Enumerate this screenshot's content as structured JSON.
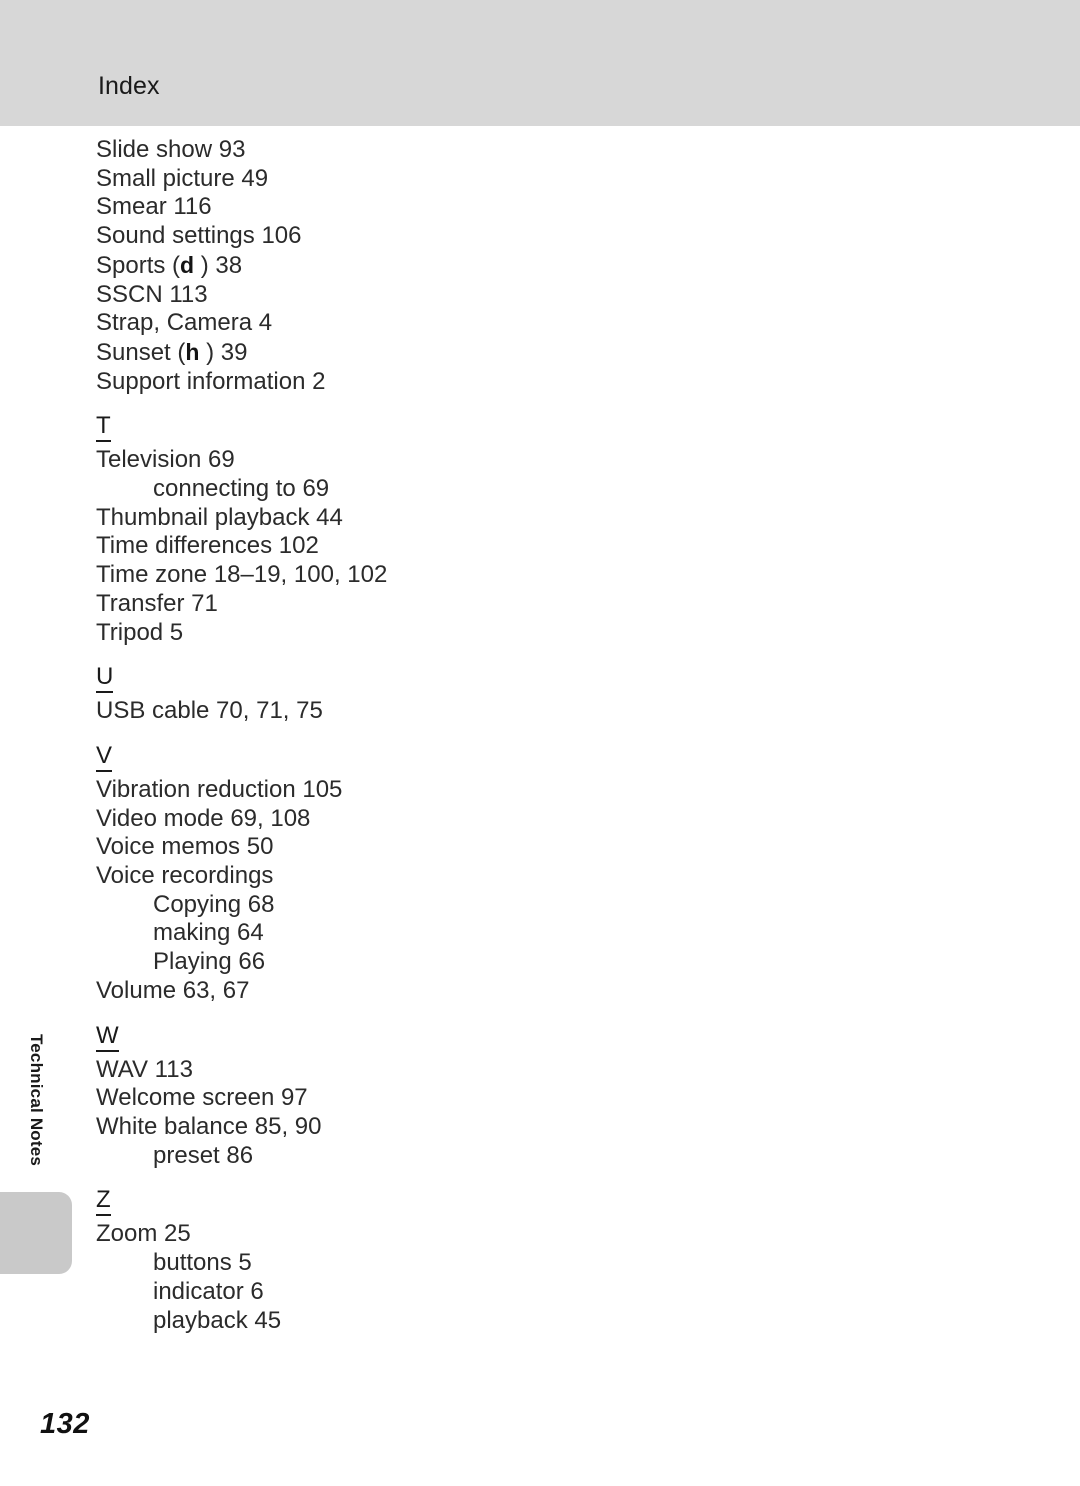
{
  "header": {
    "title": "Index",
    "band_color": "#d7d7d7"
  },
  "side_tab": {
    "label": "Technical Notes",
    "tab_color": "#c9c9c9"
  },
  "page": {
    "number": "132"
  },
  "index": {
    "continued_entries": [
      {
        "text": "Slide show 93",
        "level": 0
      },
      {
        "text": "Small picture 49",
        "level": 0
      },
      {
        "text": "Smear 116",
        "level": 0
      },
      {
        "text": "Sound settings 106",
        "level": 0
      },
      {
        "text": "Sports (",
        "glyph": "d",
        "text_after": " ) 38",
        "level": 0,
        "has_glyph": true
      },
      {
        "text": "SSCN 113",
        "level": 0
      },
      {
        "text": "Strap, Camera 4",
        "level": 0
      },
      {
        "text": "Sunset (",
        "glyph": "h",
        "text_after": " ) 39",
        "level": 0,
        "has_glyph": true
      },
      {
        "text": "Support information 2",
        "level": 0
      }
    ],
    "sections": [
      {
        "letter": "T",
        "entries": [
          {
            "text": "Television 69",
            "level": 0
          },
          {
            "text": "connecting to 69",
            "level": 1
          },
          {
            "text": "Thumbnail playback 44",
            "level": 0
          },
          {
            "text": "Time differences 102",
            "level": 0
          },
          {
            "text": "Time zone 18–19, 100, 102",
            "level": 0
          },
          {
            "text": "Transfer 71",
            "level": 0
          },
          {
            "text": "Tripod 5",
            "level": 0
          }
        ]
      },
      {
        "letter": "U",
        "entries": [
          {
            "text": "USB cable 70, 71, 75",
            "level": 0
          }
        ]
      },
      {
        "letter": "V",
        "entries": [
          {
            "text": "Vibration reduction 105",
            "level": 0
          },
          {
            "text": "Video mode 69, 108",
            "level": 0
          },
          {
            "text": "Voice memos 50",
            "level": 0
          },
          {
            "text": "Voice recordings",
            "level": 0
          },
          {
            "text": "Copying 68",
            "level": 1
          },
          {
            "text": "making 64",
            "level": 1
          },
          {
            "text": "Playing 66",
            "level": 1
          },
          {
            "text": "Volume 63, 67",
            "level": 0
          }
        ]
      },
      {
        "letter": "W",
        "entries": [
          {
            "text": "WAV 113",
            "level": 0
          },
          {
            "text": "Welcome screen 97",
            "level": 0
          },
          {
            "text": "White balance 85, 90",
            "level": 0
          },
          {
            "text": "preset 86",
            "level": 1
          }
        ]
      },
      {
        "letter": "Z",
        "entries": [
          {
            "text": "Zoom 25",
            "level": 0
          },
          {
            "text": "buttons 5",
            "level": 1
          },
          {
            "text": "indicator 6",
            "level": 1
          },
          {
            "text": "playback 45",
            "level": 1
          }
        ]
      }
    ]
  }
}
